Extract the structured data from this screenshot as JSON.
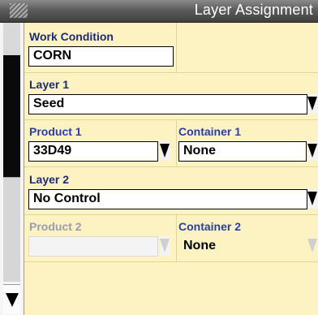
{
  "window": {
    "title": "Layer Assignment"
  },
  "work_condition": {
    "label": "Work Condition",
    "value": "CORN"
  },
  "layer1": {
    "label": "Layer 1",
    "value": "Seed",
    "product": {
      "label": "Product 1",
      "value": "33D49"
    },
    "container": {
      "label": "Container 1",
      "value": "None"
    }
  },
  "layer2": {
    "label": "Layer 2",
    "value": "No Control",
    "product": {
      "label": "Product 2",
      "value": ""
    },
    "container": {
      "label": "Container 2",
      "value": "None"
    }
  },
  "icons": {
    "title_grip": "grip-icon",
    "dropdown": "dropdown-arrow-icon",
    "scroll_down": "scroll-down-arrow-icon"
  },
  "colors": {
    "background": "#fdf2c2",
    "label_active": "#2a3ea8",
    "label_disabled": "#9a9cae",
    "titlebar": "#5c5c5c"
  }
}
